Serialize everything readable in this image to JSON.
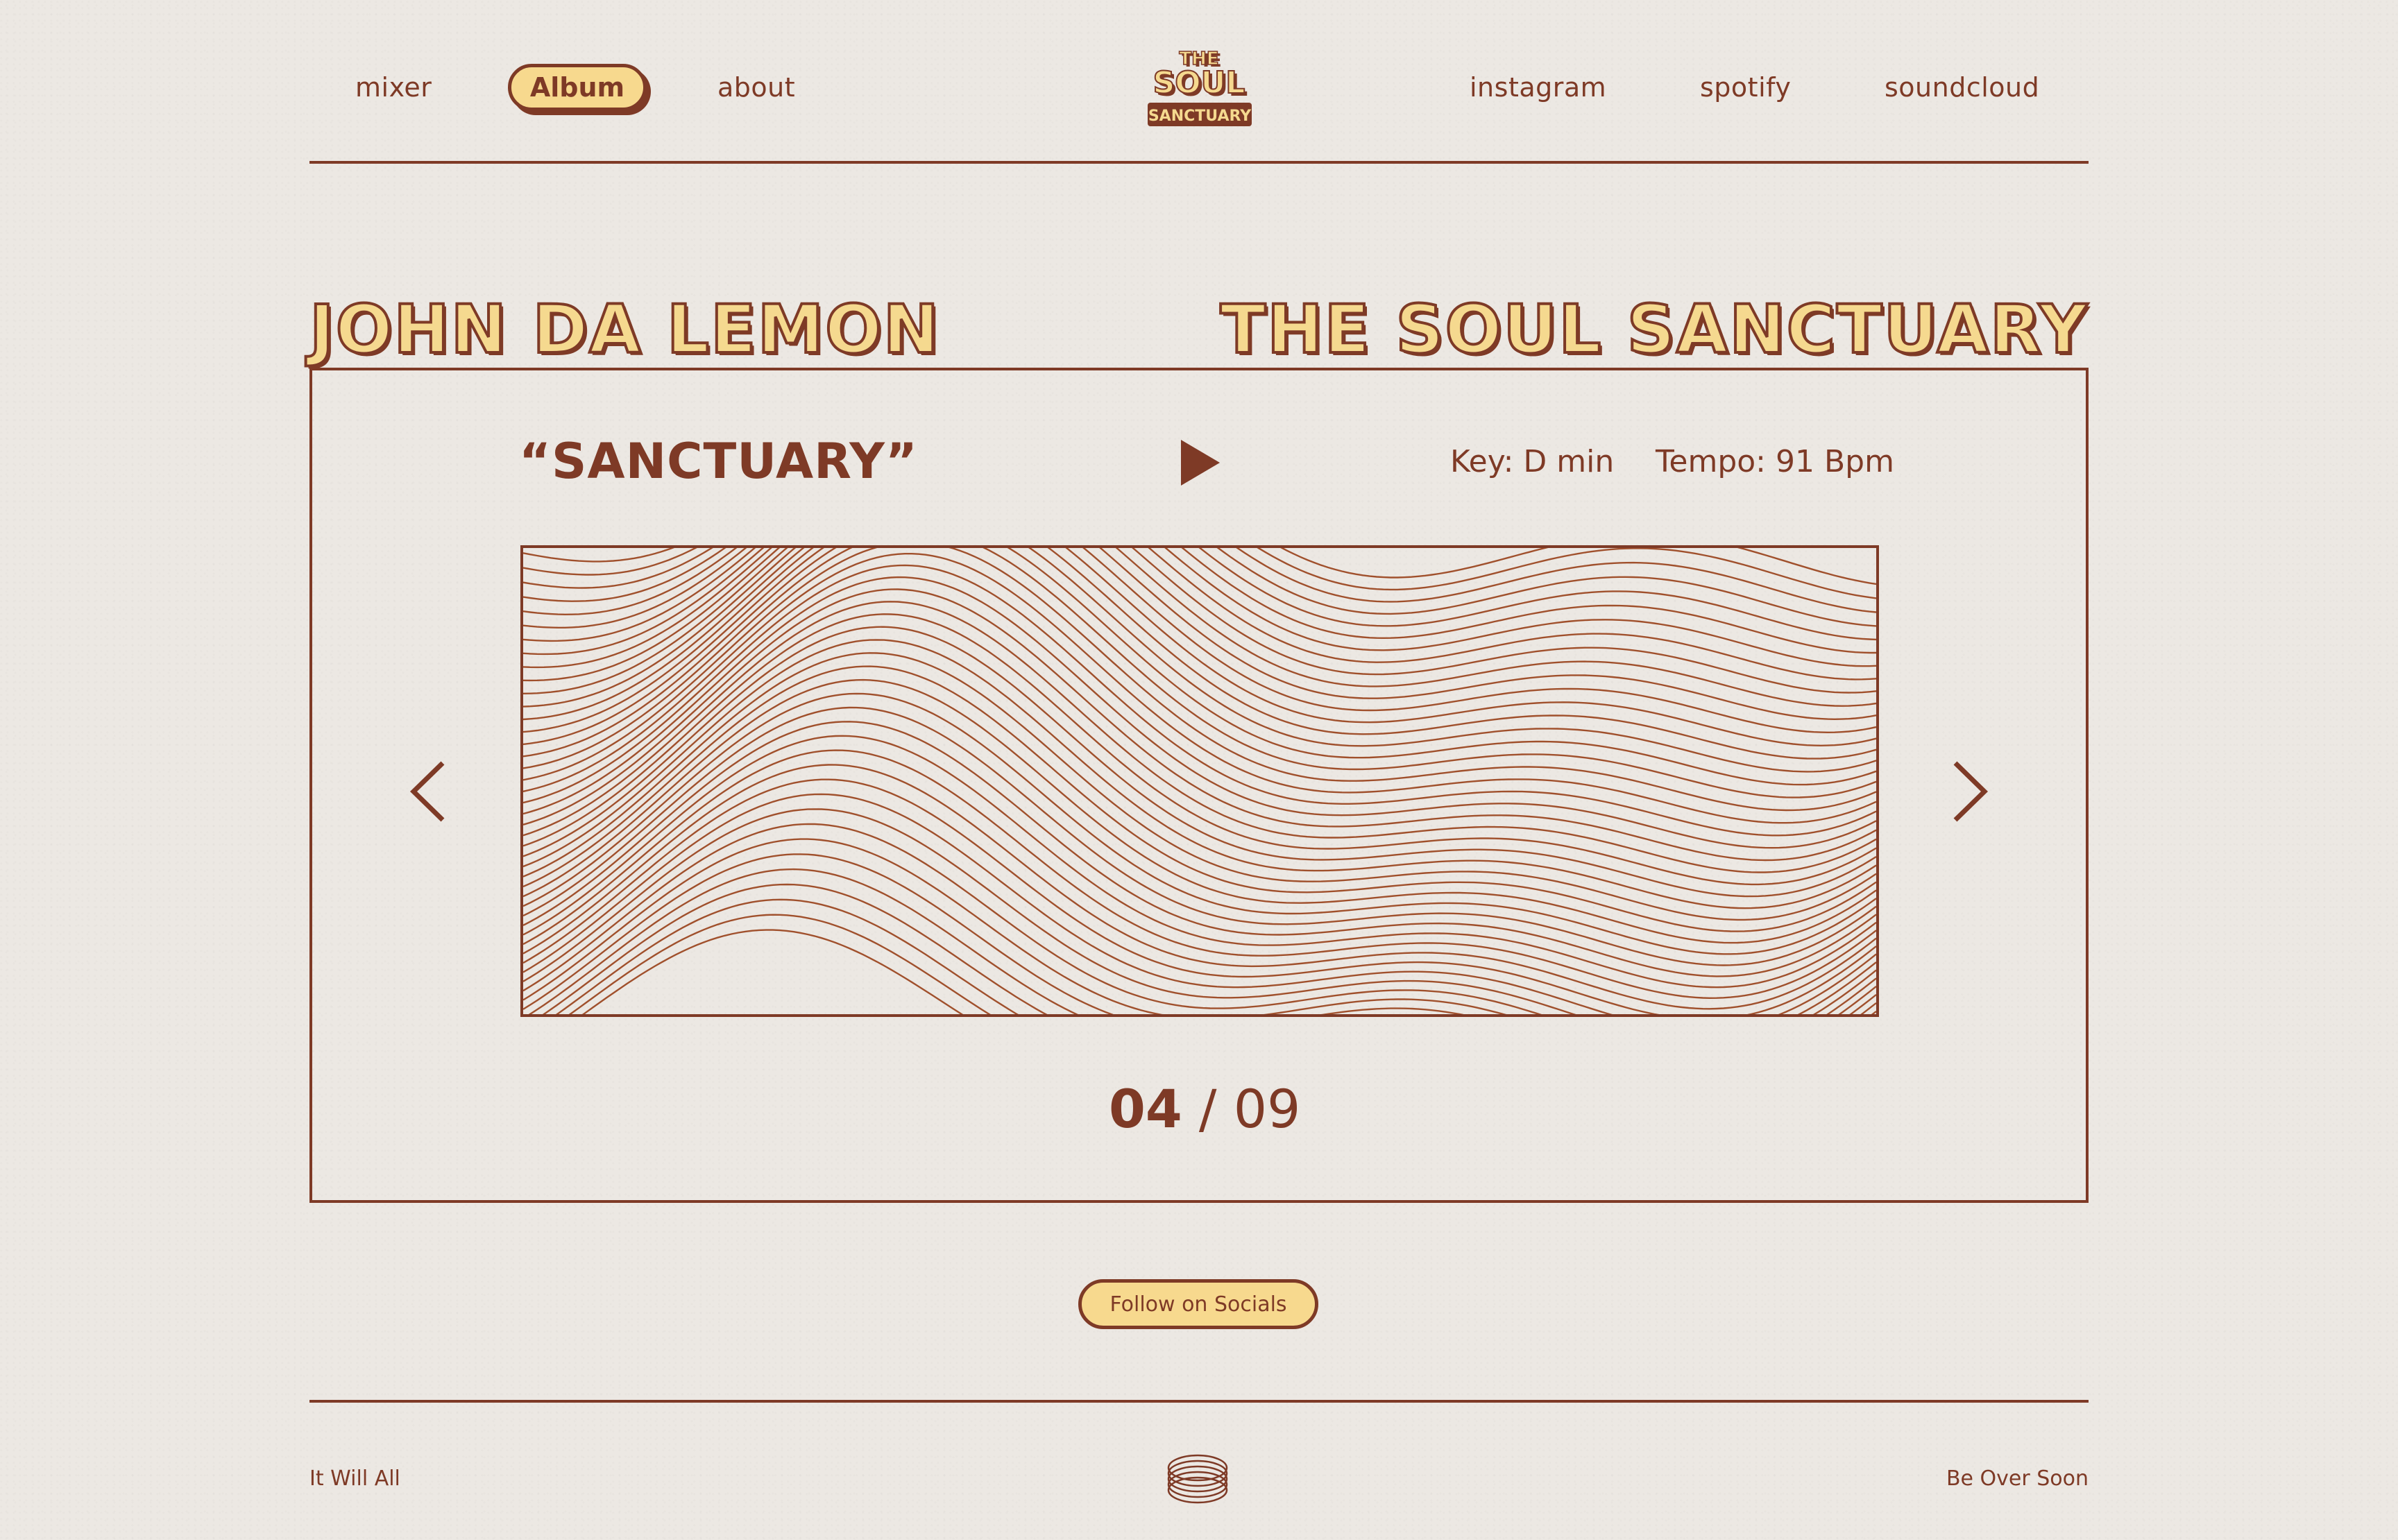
{
  "nav": {
    "left": [
      {
        "label": "mixer"
      },
      {
        "label": "Album"
      },
      {
        "label": "about"
      }
    ],
    "right": [
      {
        "label": "instagram"
      },
      {
        "label": "spotify"
      },
      {
        "label": "soundcloud"
      }
    ],
    "logo_text": [
      "THE",
      "SOUL",
      "SANCTUARY"
    ]
  },
  "headline": {
    "artist": "JOHN DA LEMON",
    "album": "THE SOUL SANCTUARY"
  },
  "player": {
    "track_title": "“SANCTUARY”",
    "key": "Key: D min",
    "tempo": "Tempo: 91 Bpm",
    "current": "04",
    "separator": " / ",
    "total": "09"
  },
  "cta": {
    "follow_label": "Follow on Socials"
  },
  "footer": {
    "left": "It Will All",
    "right": "Be Over Soon"
  },
  "colors": {
    "background": "#ece8e3",
    "primary": "#7e3a26",
    "accent": "#f7d98e",
    "line_art": "#a0502c"
  },
  "icons": {
    "play": "play-icon",
    "prev": "chevron-left-icon",
    "next": "chevron-right-icon",
    "footer": "rings-icon"
  }
}
